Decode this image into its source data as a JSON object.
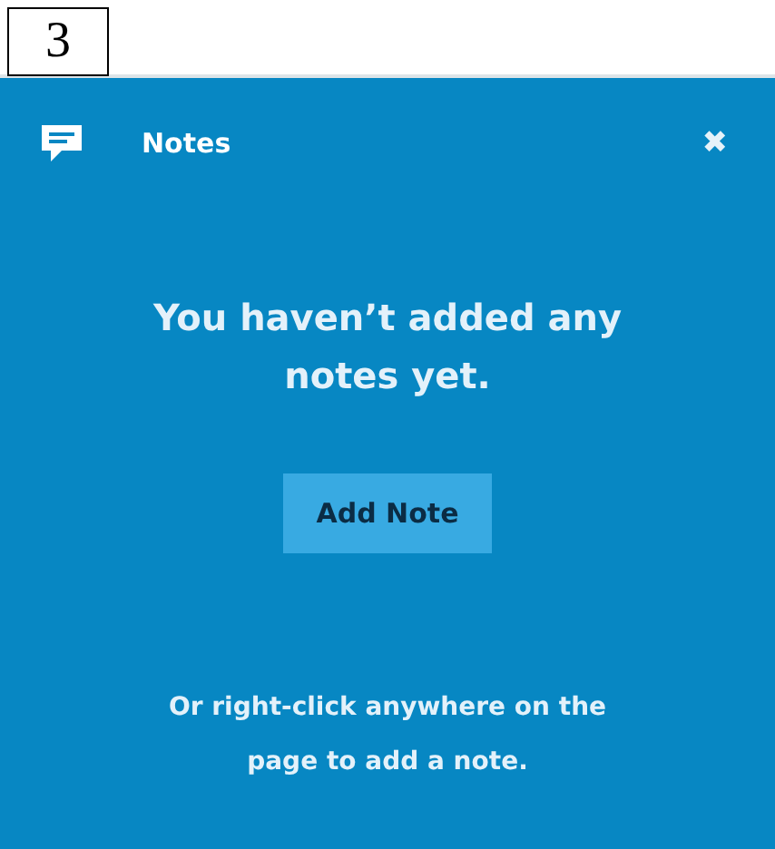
{
  "step_label": "3",
  "panel": {
    "title": "Notes",
    "close": "✖",
    "message": "You haven’t added any notes yet.",
    "button": "Add Note",
    "hint": "Or right-click anywhere on the page to add a note."
  }
}
